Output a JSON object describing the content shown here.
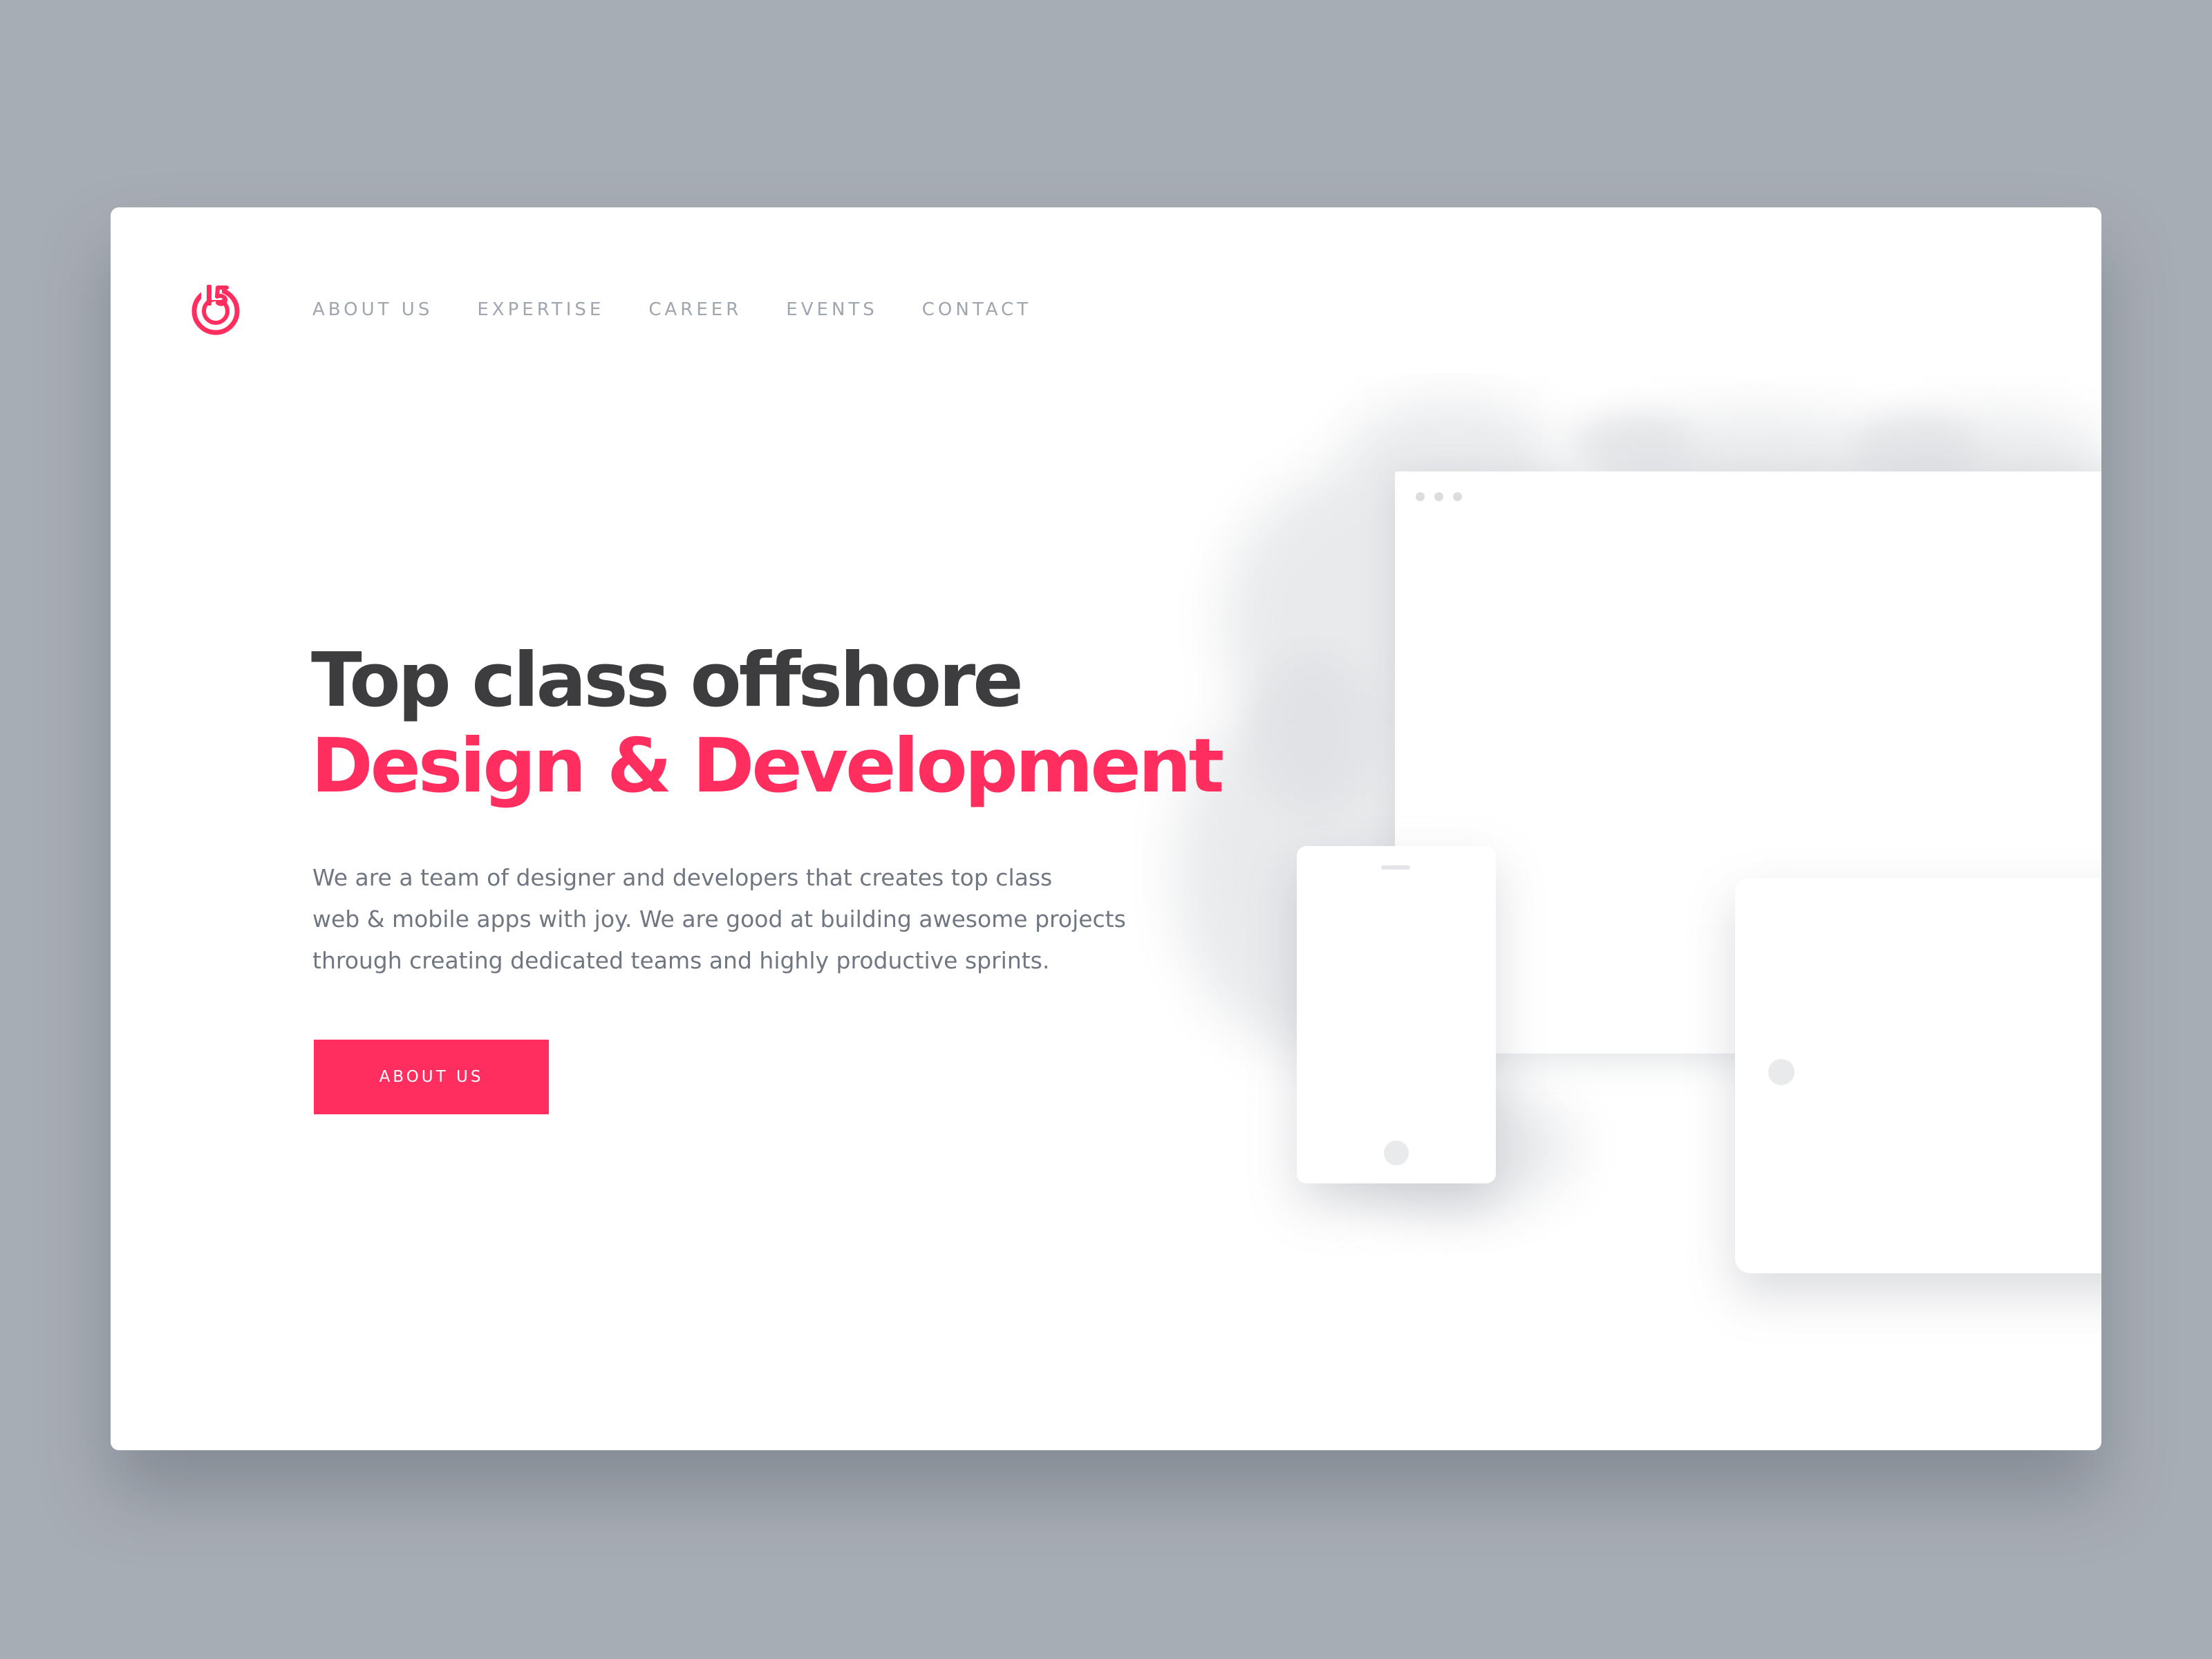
{
  "brand": {
    "logo_icon": "power-15-logo-icon",
    "accent_color": "#ff2e5f"
  },
  "nav": {
    "items": [
      {
        "label": "ABOUT US"
      },
      {
        "label": "EXPERTISE"
      },
      {
        "label": "CAREER"
      },
      {
        "label": "EVENTS"
      },
      {
        "label": "CONTACT"
      }
    ]
  },
  "hero": {
    "title_line1": "Top class offshore",
    "title_line2": "Design & Development",
    "description_lines": [
      "We are a team of designer and developers that creates top class",
      "web & mobile apps with joy. We are good at building awesome projects",
      "through creating dedicated teams and highly productive sprints."
    ],
    "cta_label": "ABOUT US"
  },
  "illustration": {
    "devices": [
      "browser-window",
      "phone",
      "tablet"
    ]
  }
}
